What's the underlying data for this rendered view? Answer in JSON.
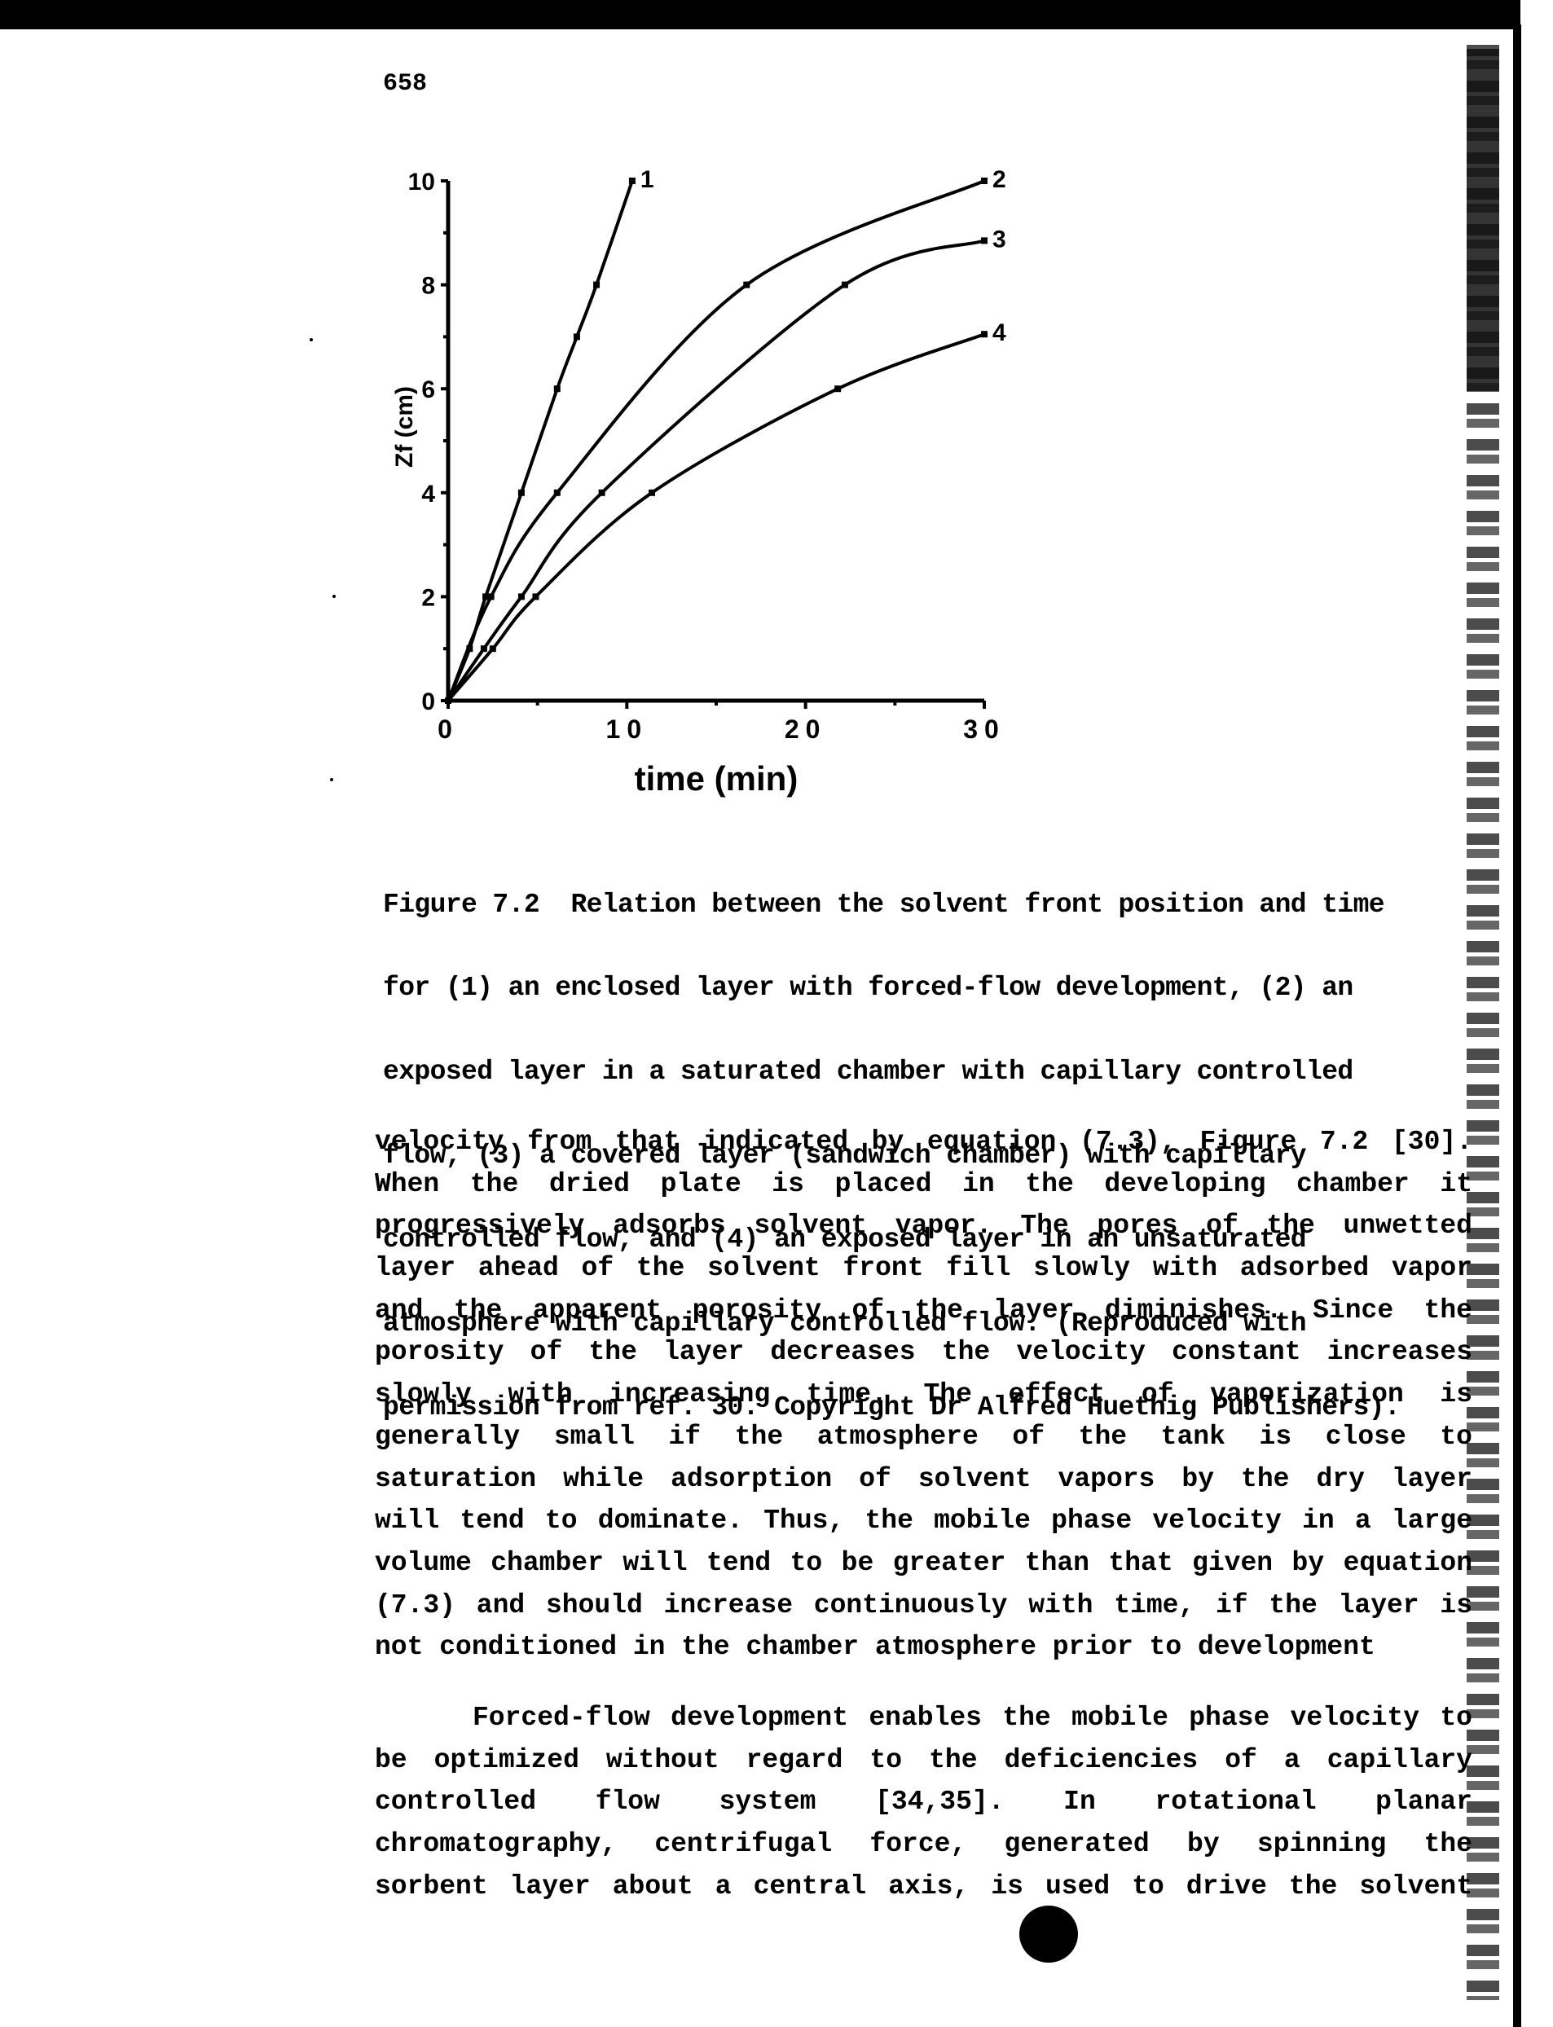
{
  "page_number": "658",
  "chart_data": {
    "type": "line",
    "xlabel": "time (min)",
    "ylabel": "Zf (cm)",
    "xlim": [
      0,
      30
    ],
    "ylim": [
      0,
      10
    ],
    "x_ticks": [
      0,
      10,
      20,
      30
    ],
    "y_ticks": [
      0,
      2,
      4,
      6,
      8,
      10
    ],
    "grid": false,
    "legend": "curve-end labels",
    "series": [
      {
        "name": "1",
        "points": [
          [
            0,
            0
          ],
          [
            1.2,
            1
          ],
          [
            2.1,
            2
          ],
          [
            4.1,
            4
          ],
          [
            6.1,
            6
          ],
          [
            7.2,
            7
          ],
          [
            8.3,
            8
          ],
          [
            10.3,
            10
          ]
        ]
      },
      {
        "name": "2",
        "points": [
          [
            0,
            0
          ],
          [
            2.4,
            2
          ],
          [
            6.1,
            4
          ],
          [
            16.7,
            8
          ],
          [
            30,
            10
          ]
        ]
      },
      {
        "name": "3",
        "points": [
          [
            0,
            0
          ],
          [
            2.0,
            1
          ],
          [
            4.1,
            2
          ],
          [
            8.6,
            4
          ],
          [
            22.2,
            8
          ],
          [
            30,
            8.85
          ]
        ]
      },
      {
        "name": "4",
        "points": [
          [
            0,
            0
          ],
          [
            2.5,
            1
          ],
          [
            4.9,
            2
          ],
          [
            11.4,
            4
          ],
          [
            21.8,
            6
          ],
          [
            30,
            7.05
          ]
        ]
      }
    ]
  },
  "caption": [
    "Figure 7.2  Relation between the solvent front position and time",
    "for (1) an enclosed layer with forced-flow development, (2) an",
    "exposed layer in a saturated chamber with capillary controlled",
    "flow, (3) a covered layer (sandwich chamber) with capillary",
    "controlled flow, and (4) an exposed layer in an unsaturated",
    "atmosphere with capillary controlled flow. (Reproduced with",
    "permission from ref. 30. Copyright Dr Alfred Huethig Publishers)."
  ],
  "paragraph1": [
    "velocity from that indicated by equation (7.3), Figure 7.2 [30].",
    "When the dried plate is placed in the developing chamber it",
    "progressively adsorbs solvent vapor. The pores of the unwetted",
    "layer ahead of the solvent front fill slowly with adsorbed vapor",
    "and the apparent porosity of the layer diminishes. Since the",
    "porosity of the layer decreases the velocity constant increases",
    "slowly with increasing time. The effect of vaporization is",
    "generally small if the atmosphere of the tank is close to",
    "saturation while adsorption of solvent vapors by the dry layer",
    "will tend to dominate. Thus, the mobile phase velocity in a large",
    "volume chamber will tend to be greater than that given by equation",
    "(7.3) and should increase continuously with time, if the layer is",
    "not conditioned in the chamber atmosphere prior to development"
  ],
  "paragraph2": [
    "Forced-flow development enables the mobile phase velocity to",
    "be optimized without regard to the deficiencies of a capillary",
    "controlled flow system [34,35]. In rotational planar",
    "chromatography, centrifugal force, generated by spinning the",
    "sorbent layer about a central axis, is used to drive the solvent"
  ]
}
